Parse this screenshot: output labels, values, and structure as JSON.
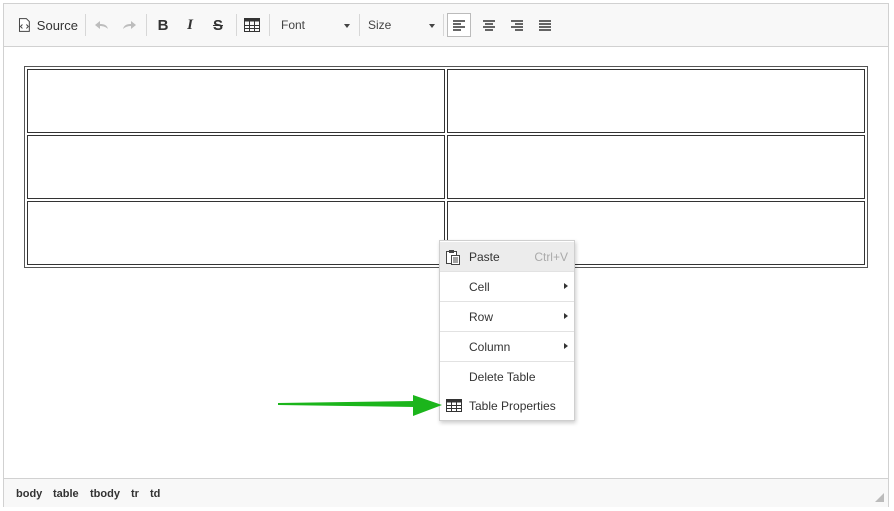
{
  "toolbar": {
    "source_label": "Source",
    "font_label": "Font",
    "size_label": "Size"
  },
  "statusbar": {
    "path": [
      "body",
      "table",
      "tbody",
      "tr",
      "td"
    ]
  },
  "context_menu": {
    "paste": {
      "label": "Paste",
      "shortcut": "Ctrl+V"
    },
    "cell": "Cell",
    "row": "Row",
    "column": "Column",
    "delete_table": "Delete Table",
    "table_properties": "Table Properties"
  },
  "colors": {
    "arrow": "#1bb51b",
    "toolbar_bg": "#f8f8f8"
  }
}
